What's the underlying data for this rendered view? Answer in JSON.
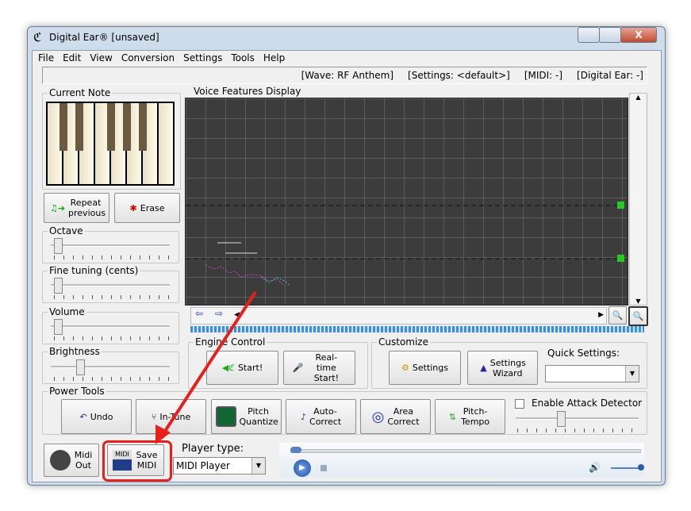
{
  "window": {
    "title": "Digital Ear® [unsaved]",
    "close": "X"
  },
  "menu": [
    "File",
    "Edit",
    "View",
    "Conversion",
    "Settings",
    "Tools",
    "Help"
  ],
  "status": {
    "wave": "[Wave: RF Anthem]",
    "settings": "[Settings: <default>]",
    "midi": "[MIDI: -]",
    "digital_ear": "[Digital Ear: -]"
  },
  "left": {
    "current_note": "Current Note",
    "repeat": "Repeat previous",
    "erase": "Erase",
    "octave": "Octave",
    "fine_tuning": "Fine tuning (cents)",
    "volume": "Volume",
    "brightness": "Brightness"
  },
  "display": {
    "title": "Voice Features Display"
  },
  "engine": {
    "title": "Engine Control",
    "start": "Start!",
    "realtime": "Real-time Start!"
  },
  "customize": {
    "title": "Customize",
    "settings": "Settings",
    "wizard": "Settings Wizard",
    "quick_label": "Quick Settings:",
    "quick_value": ""
  },
  "power": {
    "title": "Power Tools",
    "undo": "Undo",
    "intune": "In-Tune",
    "pitch_quantize": "Pitch Quantize",
    "auto_correct": "Auto-Correct",
    "area_correct": "Area Correct",
    "pitch_tempo": "Pitch-Tempo",
    "attack": "Enable Attack Detector",
    "attack_checked": false
  },
  "bottom": {
    "midi_out": "Midi Out",
    "save_midi": "Save MIDI",
    "midi_icon": "MIDI",
    "player_label": "Player type:",
    "player_value": "MIDI Player"
  },
  "colors": {
    "highlight": "#e8201c",
    "progress": "#3a8ee6"
  }
}
